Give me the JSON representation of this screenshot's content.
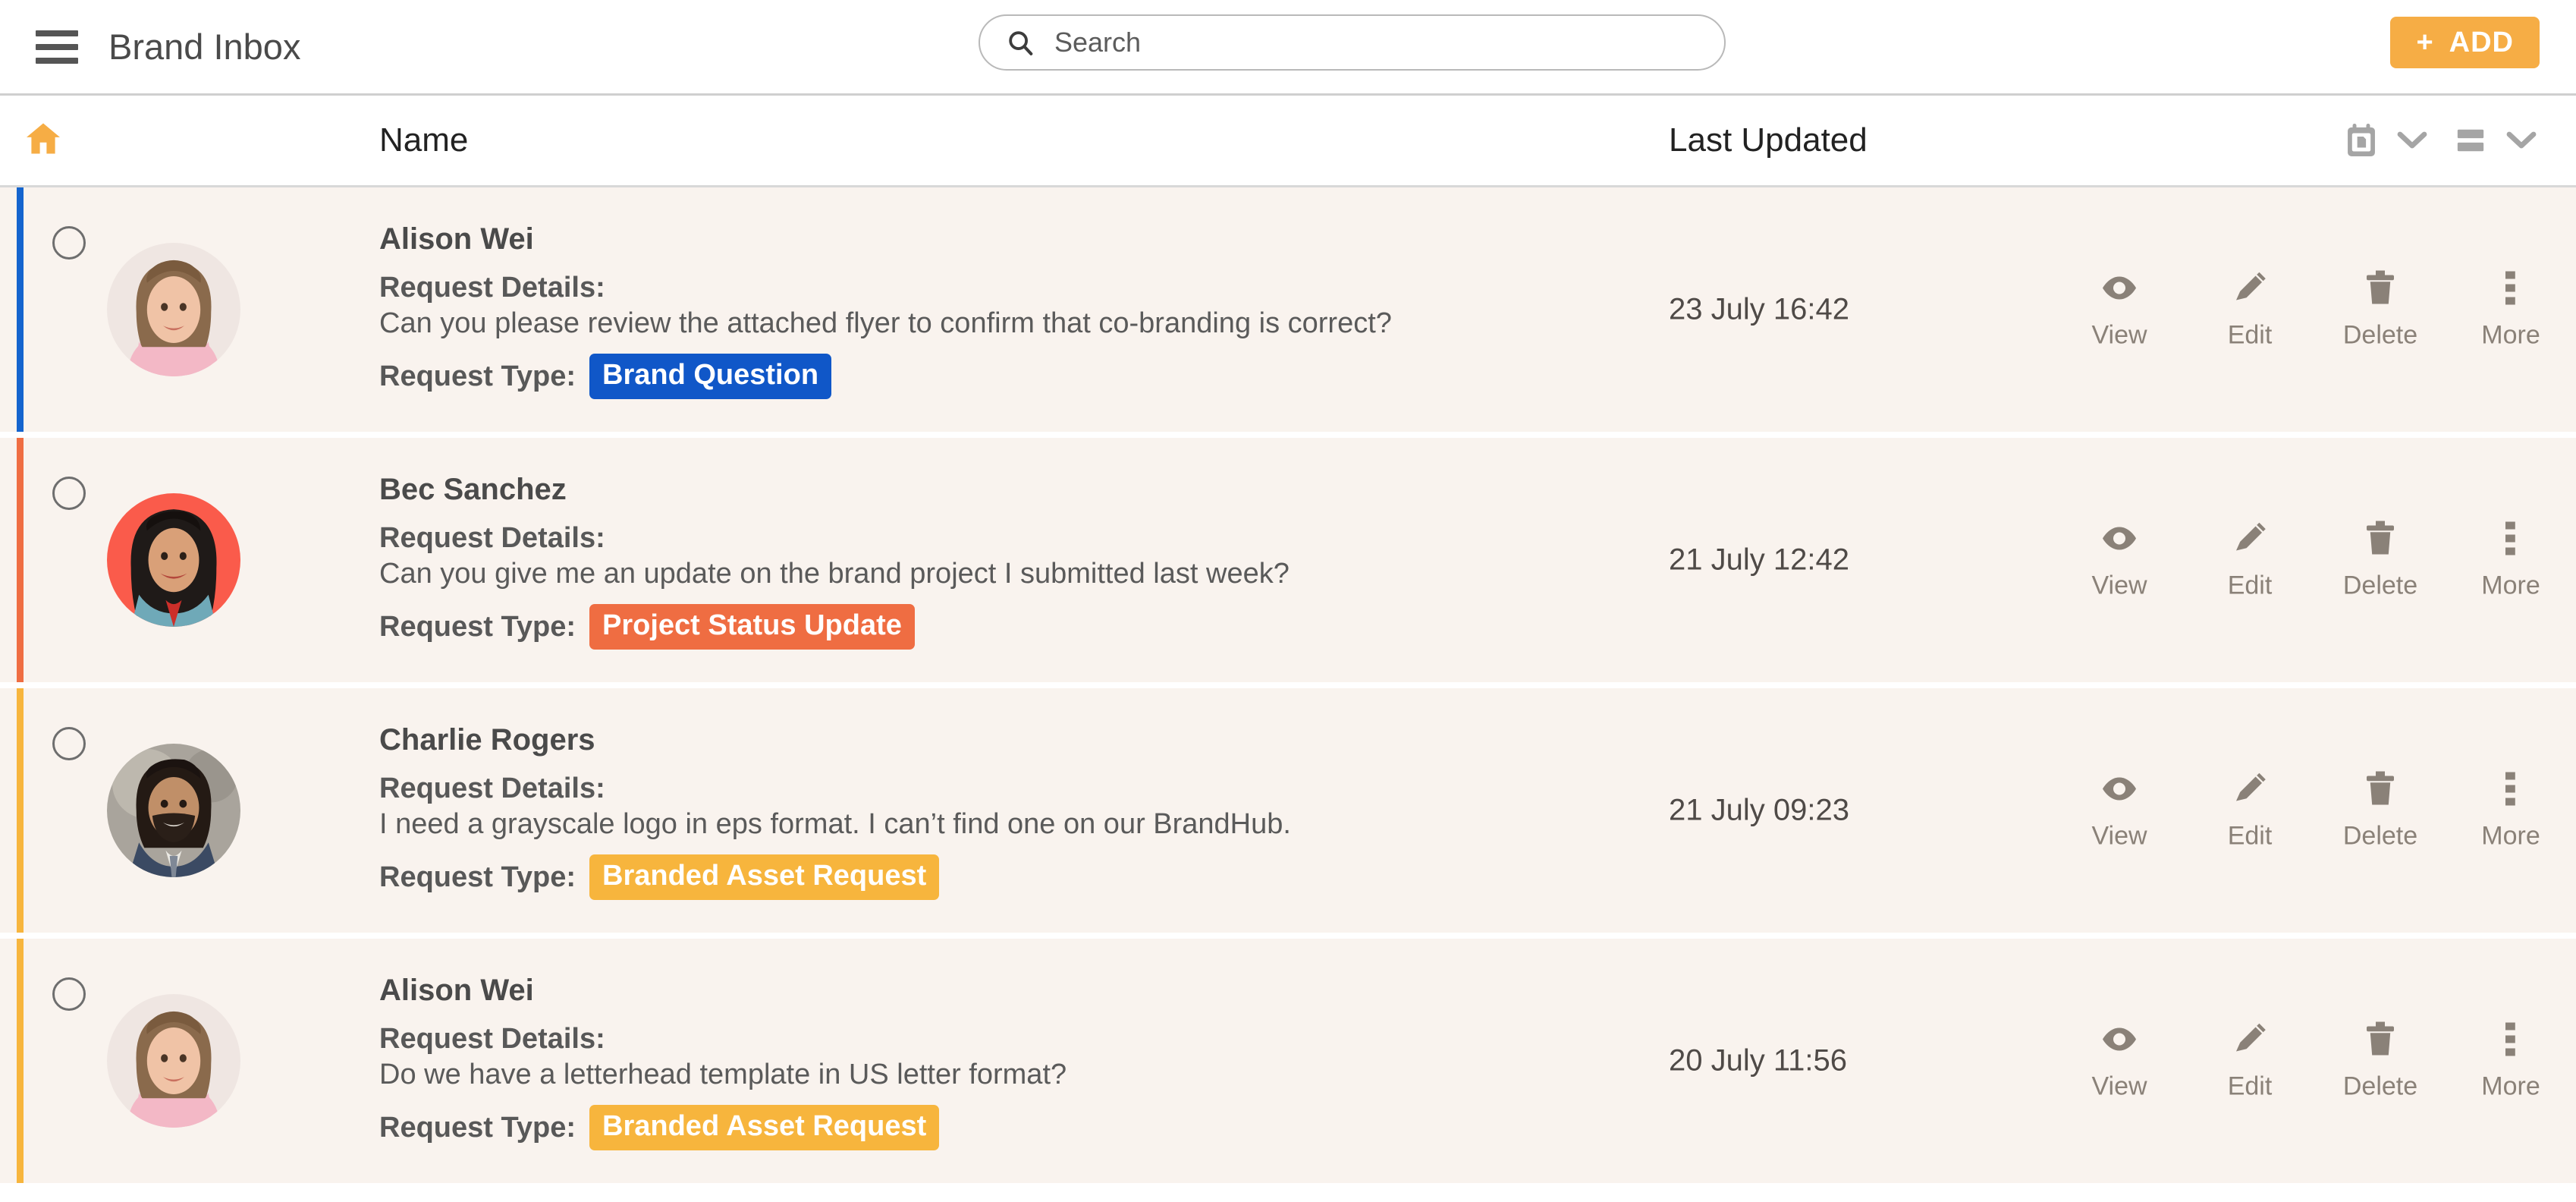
{
  "header": {
    "menu_icon": "hamburger-menu-icon",
    "title": "Brand Inbox",
    "search": {
      "icon": "search-icon",
      "placeholder": "Search",
      "value": ""
    },
    "add_button": {
      "plus": "+",
      "label": "ADD"
    }
  },
  "column_header": {
    "home_icon": "home-icon",
    "name_label": "Name",
    "last_updated_label": "Last Updated",
    "tools": [
      {
        "icon": "calendar-document-icon",
        "chevron": "chevron-down-icon"
      },
      {
        "icon": "list-rows-icon",
        "chevron": "chevron-down-icon"
      }
    ]
  },
  "labels": {
    "request_details": "Request Details:",
    "request_type": "Request Type:"
  },
  "actions": [
    {
      "name": "view",
      "icon": "eye-icon",
      "label": "View"
    },
    {
      "name": "edit",
      "icon": "pencil-icon",
      "label": "Edit"
    },
    {
      "name": "delete",
      "icon": "trash-icon",
      "label": "Delete"
    },
    {
      "name": "more",
      "icon": "more-vertical-icon",
      "label": "More"
    }
  ],
  "colors": {
    "accent_orange": "#f6ad45",
    "badge_brand_question": "#1057c8",
    "badge_project_status": "#ef6d42",
    "badge_branded_asset": "#f7b53d",
    "row_background": "#f9f3ee",
    "border_blue": "#1464ce",
    "border_red": "#ef6d42",
    "border_yellow": "#f7b53d"
  },
  "rows": [
    {
      "accent": "#1464ce",
      "selected": false,
      "avatar": "avatar-alison-wei",
      "name": "Alison Wei",
      "detail": "Can you please review the attached flyer to confirm that co-branding is correct?",
      "type": "Brand Question",
      "type_color": "#1057c8",
      "last_updated": "23 July 16:42"
    },
    {
      "accent": "#ef6d42",
      "selected": false,
      "avatar": "avatar-bec-sanchez",
      "name": "Bec Sanchez",
      "detail": "Can you give me an update on the brand project I submitted last week?",
      "type": "Project Status Update",
      "type_color": "#ef6d42",
      "last_updated": "21 July 12:42"
    },
    {
      "accent": "#f7b53d",
      "selected": false,
      "avatar": "avatar-charlie-rogers",
      "name": "Charlie Rogers",
      "detail": "I need a grayscale logo in eps format. I can’t find one on our BrandHub.",
      "type": "Branded Asset Request",
      "type_color": "#f7b53d",
      "last_updated": "21 July 09:23"
    },
    {
      "accent": "#f7b53d",
      "selected": false,
      "avatar": "avatar-alison-wei",
      "name": "Alison Wei",
      "detail": "Do we have a letterhead template in US letter format?",
      "type": "Branded Asset Request",
      "type_color": "#f7b53d",
      "last_updated": "20 July 11:56"
    }
  ]
}
